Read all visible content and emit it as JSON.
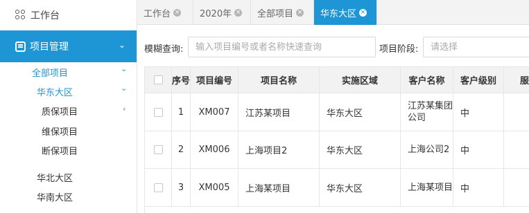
{
  "sidebar": {
    "home_label": "工作台",
    "project_mgmt_label": "项目管理",
    "all_projects_label": "全部项目",
    "east_china_label": "华东大区",
    "warranty_label": "质保项目",
    "maintenance_label": "维保项目",
    "broken_label": "断保项目",
    "north_china_label": "华北大区",
    "south_china_label": "华南大区"
  },
  "tabs": [
    {
      "label": "工作台"
    },
    {
      "label": "2020年"
    },
    {
      "label": "全部项目"
    },
    {
      "label": "华东大区",
      "active": true
    }
  ],
  "filter": {
    "fuzzy_label": "模糊查询:",
    "fuzzy_placeholder": "输入项目编号或者名称快速查询",
    "stage_label": "项目阶段:",
    "stage_placeholder": "请选择"
  },
  "table": {
    "headers": [
      "序号",
      "项目编号",
      "项目名称",
      "实施区域",
      "客户名称",
      "客户级别",
      "服"
    ],
    "rows": [
      {
        "no": "1",
        "code": "XM007",
        "name": "江苏某项目",
        "area": "华东大区",
        "customer": "江苏某集团公司",
        "level": "中"
      },
      {
        "no": "2",
        "code": "XM006",
        "name": "上海项目2",
        "area": "华东大区",
        "customer": "上海公司2",
        "level": "中"
      },
      {
        "no": "3",
        "code": "XM005",
        "name": "上海某项目",
        "area": "华东大区",
        "customer": "上海某项目",
        "level": "中"
      }
    ]
  },
  "colors": {
    "accent": "#1e95d4"
  }
}
